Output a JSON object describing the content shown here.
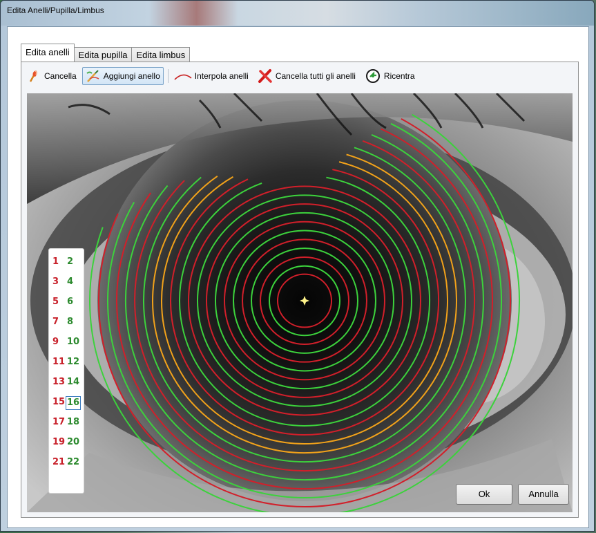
{
  "window": {
    "title": "Edita Anelli/Pupilla/Limbus"
  },
  "tabs": [
    {
      "label": "Edita anelli",
      "active": true
    },
    {
      "label": "Edita pupilla",
      "active": false
    },
    {
      "label": "Edita limbus",
      "active": false
    }
  ],
  "toolbar": {
    "cancella": "Cancella",
    "aggiungi": "Aggiungi anello",
    "interpola": "Interpola anelli",
    "cancella_tutti": "Cancella tutti gli anelli",
    "ricentra": "Ricentra"
  },
  "ring_list": {
    "numbers": [
      "1",
      "2",
      "3",
      "4",
      "5",
      "6",
      "7",
      "8",
      "9",
      "10",
      "11",
      "12",
      "13",
      "14",
      "15",
      "16",
      "17",
      "18",
      "19",
      "20",
      "21",
      "22"
    ],
    "selected": "16"
  },
  "colors": {
    "odd_ring": "#d21f2a",
    "even_ring": "#3cd23c",
    "highlight_ring": "#f2a21a",
    "center_marker": "#fff48a"
  },
  "buttons": {
    "ok": "Ok",
    "cancel": "Annulla"
  }
}
